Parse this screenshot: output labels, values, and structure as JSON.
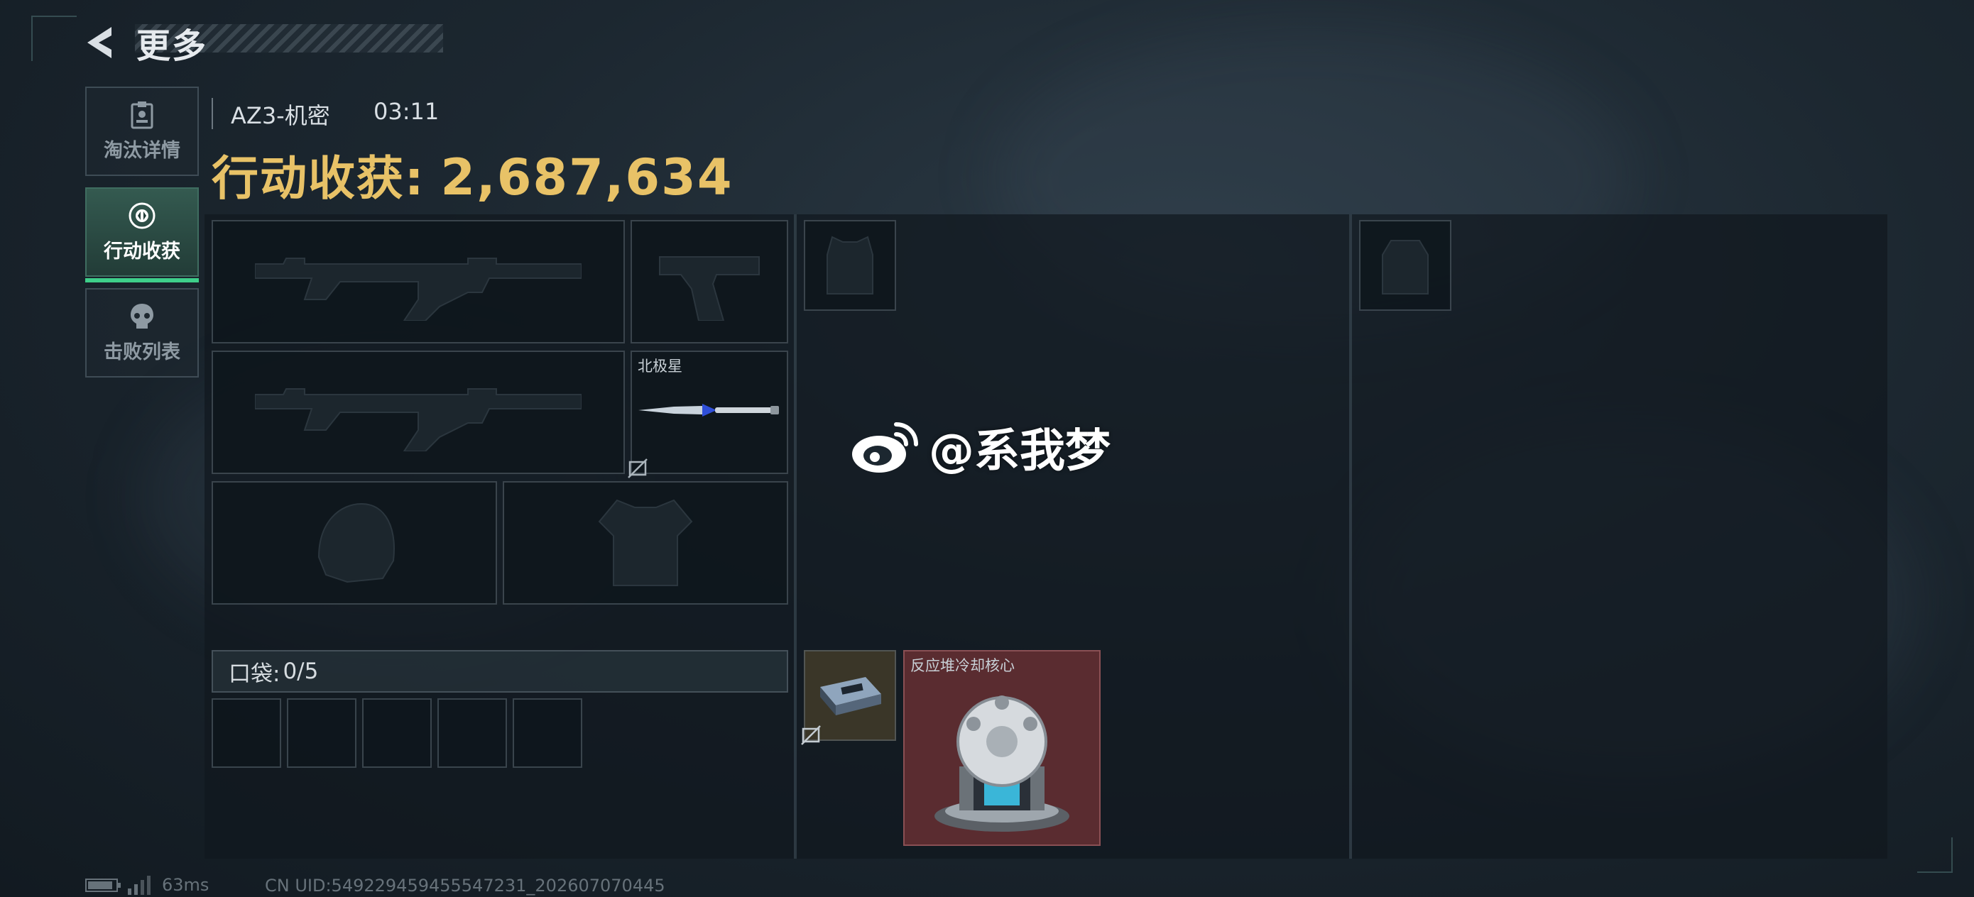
{
  "header": {
    "title": "更多"
  },
  "tabs": [
    {
      "label": "淘汰详情",
      "icon": "badge-icon",
      "active": false
    },
    {
      "label": "行动收获",
      "icon": "harvest-icon",
      "active": true
    },
    {
      "label": "击败列表",
      "icon": "skull-icon",
      "active": false
    }
  ],
  "match": {
    "map": "AZ3-机密",
    "time": "03:11"
  },
  "loot": {
    "label": "行动收获:",
    "value": "2,687,634"
  },
  "equipment": {
    "primary_weapon_1": {
      "icon": "assault-rifle-icon"
    },
    "pistol": {
      "icon": "pistol-icon"
    },
    "primary_weapon_2": {
      "icon": "assault-rifle-icon"
    },
    "melee": {
      "label": "北极星",
      "icon": "knife-icon",
      "unsearched_icon": "unsearched-icon"
    },
    "helmet": {
      "icon": "helmet-icon"
    },
    "armor": {
      "icon": "body-armor-icon"
    },
    "chest_rig": {
      "icon": "chest-rig-icon"
    },
    "backpack": {
      "icon": "backpack-icon"
    }
  },
  "pocket": {
    "label": "口袋:",
    "value": "0/5",
    "slots": 5
  },
  "items": [
    {
      "name": "",
      "icon": "ammo-box-icon",
      "unsearched_icon": "unsearched-icon"
    },
    {
      "name": "反应堆冷却核心",
      "icon": "reactor-core-icon",
      "rarity_color": "#7a3d40"
    }
  ],
  "watermark": {
    "text": "@系我梦",
    "icon": "weibo-icon"
  },
  "status": {
    "ping": "63ms",
    "uid": "CN UID:5492294594555472​31_202607070445"
  },
  "colors": {
    "accent": "#3ecf8a",
    "gold": "#e8c267",
    "panel": "#10181e"
  }
}
